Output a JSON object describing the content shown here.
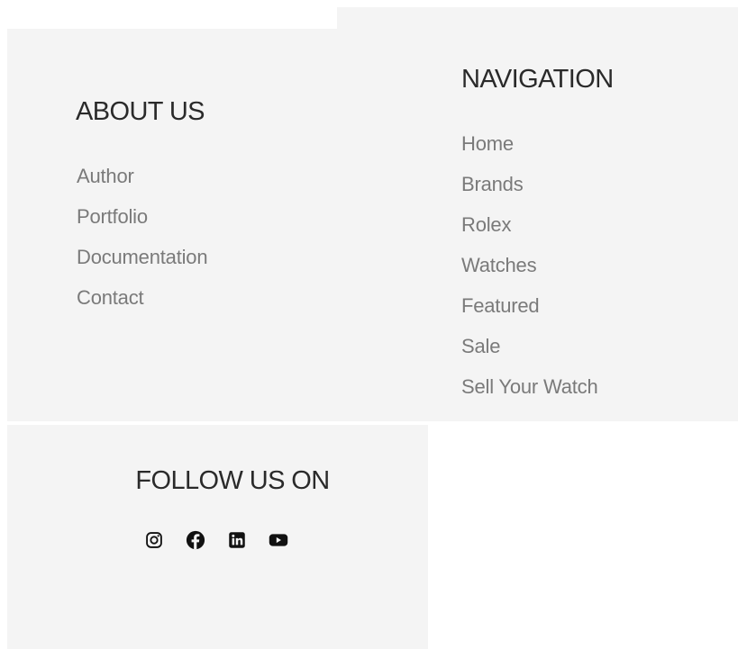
{
  "about": {
    "heading": "ABOUT US",
    "links": [
      "Author",
      "Portfolio",
      "Documentation",
      "Contact"
    ]
  },
  "navigation": {
    "heading": "NAVIGATION",
    "links": [
      "Home",
      "Brands",
      "Rolex",
      "Watches",
      "Featured",
      "Sale",
      "Sell Your Watch"
    ]
  },
  "follow": {
    "heading": "FOLLOW US ON",
    "icons": [
      "instagram-icon",
      "facebook-icon",
      "linkedin-icon",
      "youtube-icon"
    ]
  },
  "colors": {
    "panel_bg": "#f4f4f4",
    "heading": "#2a2a2a",
    "link": "#7a7a7a",
    "icon": "#111111"
  }
}
